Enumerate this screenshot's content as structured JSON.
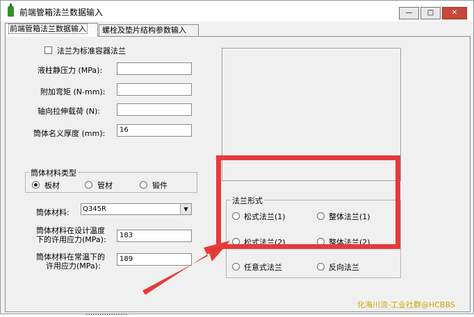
{
  "window": {
    "title": "前端管箱法兰数据输入",
    "min_glyph": "—",
    "max_glyph": "□",
    "close_glyph": "✕",
    "icon": "app-flask-icon"
  },
  "tabs": [
    {
      "label": "前端管箱法兰数据输入",
      "active": true
    },
    {
      "label": "螺栓及垫片结构参数输入",
      "active": false
    }
  ],
  "form": {
    "standard_flange_label": "法兰为标准容器法兰",
    "liquid_pressure_label": "液柱静压力 (MPa):",
    "liquid_pressure_value": "",
    "bending_moment_label": "附加弯矩 (N-mm):",
    "bending_moment_value": "",
    "axial_tension_label": "轴向拉伸载荷 (N):",
    "axial_tension_value": "",
    "shell_thickness_label": "筒体名义厚度 (mm):",
    "shell_thickness_value": "16",
    "material_type_group": "筒体材料类型",
    "material_type_options": [
      "板材",
      "管材",
      "锻件"
    ],
    "material_label": "筒体材料:",
    "material_value": "Q345R",
    "design_stress_label_1": "筒体材料在设计温度",
    "design_stress_label_2": "下的许用应力(MPa):",
    "design_stress_value": "183",
    "room_stress_label_1": "筒体材料在常温下的",
    "room_stress_label_2": "许用应力(MPa):",
    "room_stress_value": "189"
  },
  "flange_form": {
    "group_title": "法兰形式",
    "options": [
      "松式法兰(1)",
      "整体法兰(1)",
      "松式法兰(2)",
      "整体法兰(2)",
      "任意式法兰",
      "反向法兰"
    ]
  },
  "annotation": {
    "highlight_color": "#e53a3a"
  },
  "watermark": "化海川流-工业社群@HCBBS",
  "partial_text": "………………"
}
